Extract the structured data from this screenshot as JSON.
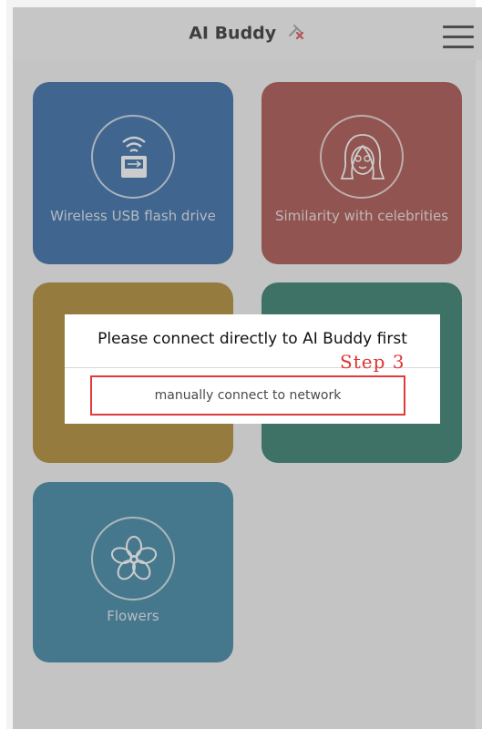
{
  "header": {
    "title": "AI Buddy",
    "status_icon": "disconnected-link-icon",
    "menu_icon": "hamburger-menu-icon"
  },
  "tiles": [
    {
      "label": "Wireless USB flash drive",
      "icon": "wifi-usb-icon",
      "color": "#1d5a9c"
    },
    {
      "label": "Similarity with celebrities",
      "icon": "woman-face-icon",
      "color": "#a03e38"
    },
    {
      "label": "",
      "icon": "",
      "color": "#a67d1a"
    },
    {
      "label": "",
      "icon": "",
      "color": "#1b6e5c"
    },
    {
      "label": "Flowers",
      "icon": "flower-icon",
      "color": "#27789a"
    }
  ],
  "dialog": {
    "message": "Please connect directly to AI Buddy first",
    "action_label": "manually connect to network",
    "step_annotation": "Step 3",
    "annotation_color": "#e03b3b"
  }
}
